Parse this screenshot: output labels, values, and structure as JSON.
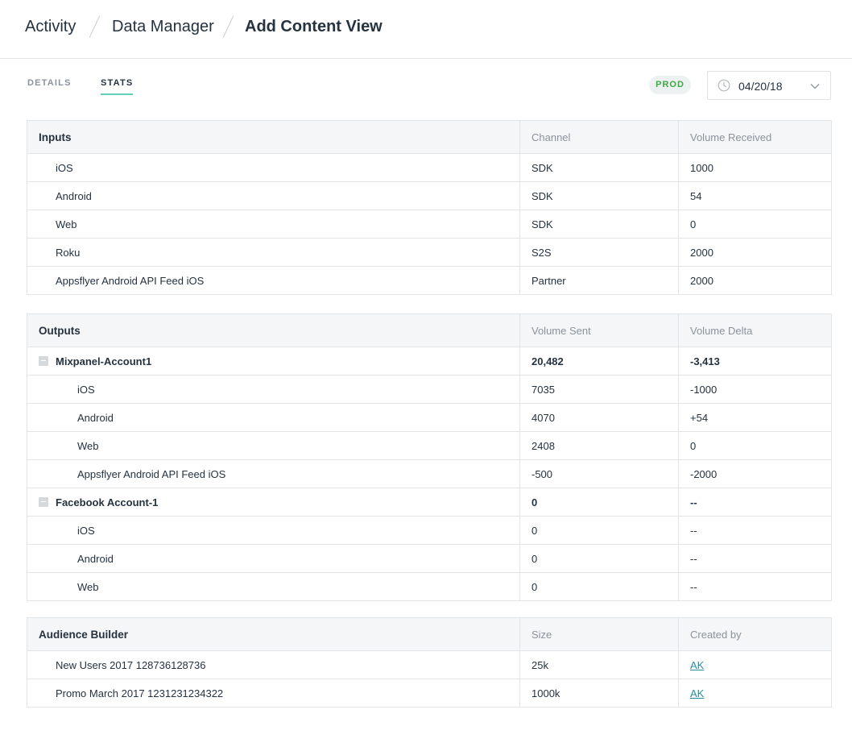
{
  "breadcrumb": {
    "items": [
      "Activity",
      "Data Manager"
    ],
    "current": "Add Content View"
  },
  "tabs": [
    {
      "label": "DETAILS",
      "active": false
    },
    {
      "label": "STATS",
      "active": true
    }
  ],
  "env_badge": "PROD",
  "date_picker": {
    "value": "04/20/18"
  },
  "colors": {
    "accent": "#5fd1b4",
    "badge_text": "#3bab43",
    "link": "#2a8c9c"
  },
  "inputs": {
    "headers": [
      "Inputs",
      "Channel",
      "Volume Received"
    ],
    "rows": [
      {
        "name": "iOS",
        "channel": "SDK",
        "volume": "1000"
      },
      {
        "name": "Android",
        "channel": "SDK",
        "volume": "54"
      },
      {
        "name": "Web",
        "channel": "SDK",
        "volume": "0"
      },
      {
        "name": "Roku",
        "channel": "S2S",
        "volume": "2000"
      },
      {
        "name": "Appsflyer Android API Feed iOS",
        "channel": "Partner",
        "volume": "2000"
      }
    ]
  },
  "outputs": {
    "headers": [
      "Outputs",
      "Volume Sent",
      "Volume Delta"
    ],
    "groups": [
      {
        "name": "Mixpanel-Account1",
        "sent": "20,482",
        "delta": "-3,413",
        "rows": [
          {
            "name": "iOS",
            "sent": "7035",
            "delta": "-1000"
          },
          {
            "name": "Android",
            "sent": "4070",
            "delta": "+54"
          },
          {
            "name": "Web",
            "sent": "2408",
            "delta": "0"
          },
          {
            "name": "Appsflyer Android API Feed iOS",
            "sent": "-500",
            "delta": "-2000"
          }
        ]
      },
      {
        "name": "Facebook Account-1",
        "sent": "0",
        "delta": "--",
        "rows": [
          {
            "name": "iOS",
            "sent": "0",
            "delta": "--"
          },
          {
            "name": "Android",
            "sent": "0",
            "delta": "--"
          },
          {
            "name": "Web",
            "sent": "0",
            "delta": "--"
          }
        ]
      }
    ]
  },
  "audience": {
    "headers": [
      "Audience Builder",
      "Size",
      "Created by"
    ],
    "rows": [
      {
        "name": "New Users 2017 128736128736",
        "size": "25k",
        "created_by": "AK"
      },
      {
        "name": "Promo March 2017 1231231234322",
        "size": "1000k",
        "created_by": "AK"
      }
    ]
  }
}
